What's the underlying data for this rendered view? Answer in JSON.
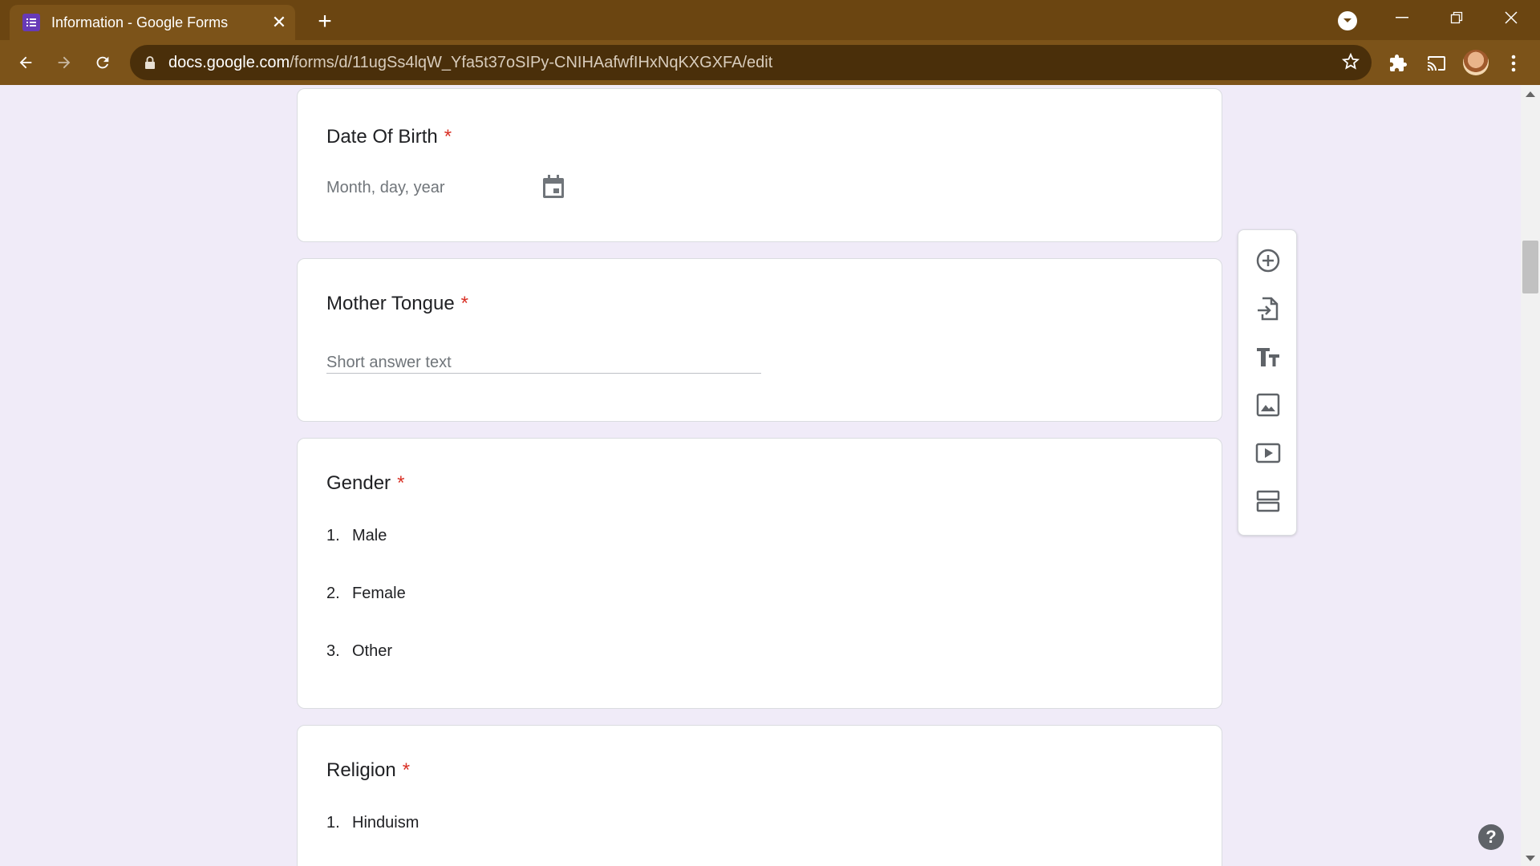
{
  "browser": {
    "tab_title": "Information - Google Forms",
    "new_tab_symbol": "+",
    "close_symbol": "✕",
    "url_host": "docs.google.com",
    "url_path": "/forms/d/11ugSs4lqW_Yfa5t37oSIPy-CNIHAafwfIHxNqKXGXFA/edit",
    "accent_color": "#6b4511"
  },
  "form": {
    "questions": [
      {
        "title": "Date Of Birth",
        "required_mark": "*",
        "hint": "Month, day, year"
      },
      {
        "title": "Mother Tongue",
        "required_mark": "*",
        "hint": "Short answer text"
      },
      {
        "title": "Gender",
        "required_mark": "*",
        "options": [
          {
            "num": "1.",
            "label": "Male"
          },
          {
            "num": "2.",
            "label": "Female"
          },
          {
            "num": "3.",
            "label": "Other"
          }
        ]
      },
      {
        "title": "Religion",
        "required_mark": "*",
        "options": [
          {
            "num": "1.",
            "label": "Hinduism"
          }
        ]
      }
    ]
  },
  "side_toolbar": {
    "icons": [
      "add-question-icon",
      "import-questions-icon",
      "add-title-icon",
      "add-image-icon",
      "add-video-icon",
      "add-section-icon"
    ]
  },
  "help_label": "?"
}
